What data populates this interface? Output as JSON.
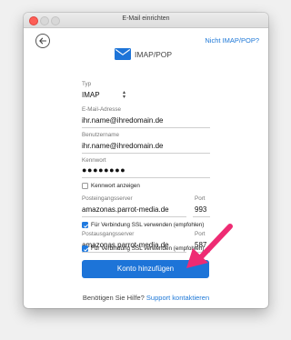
{
  "window": {
    "title": "E-Mail einrichten"
  },
  "header": {
    "nicht_link": "Nicht IMAP/POP?",
    "brand_label": "IMAP/POP"
  },
  "form": {
    "typ_label": "Typ",
    "typ_value": "IMAP",
    "email_label": "E-Mail-Adresse",
    "email_value": "ihr.name@ihredomain.de",
    "user_label": "Benutzername",
    "user_value": "ihr.name@ihredomain.de",
    "pw_label": "Kennwort",
    "pw_value": "●●●●●●●●",
    "show_pw_label": "Kennwort anzeigen",
    "in_label": "Posteingangsserver",
    "port_label": "Port",
    "in_server": "amazonas.parrot-media.de",
    "in_port": "993",
    "ssl_label": "Für Verbindung SSL verwenden (empfohlen)",
    "out_label": "Postausgangsserver",
    "out_server": "amazonas.parrot-media.de",
    "out_port": "587"
  },
  "actions": {
    "add_account": "Konto hinzufügen"
  },
  "help": {
    "text": "Benötigen Sie Hilfe?",
    "link": "Support kontaktieren"
  },
  "colors": {
    "accent": "#1d74d8",
    "arrow": "#ee2b73"
  }
}
